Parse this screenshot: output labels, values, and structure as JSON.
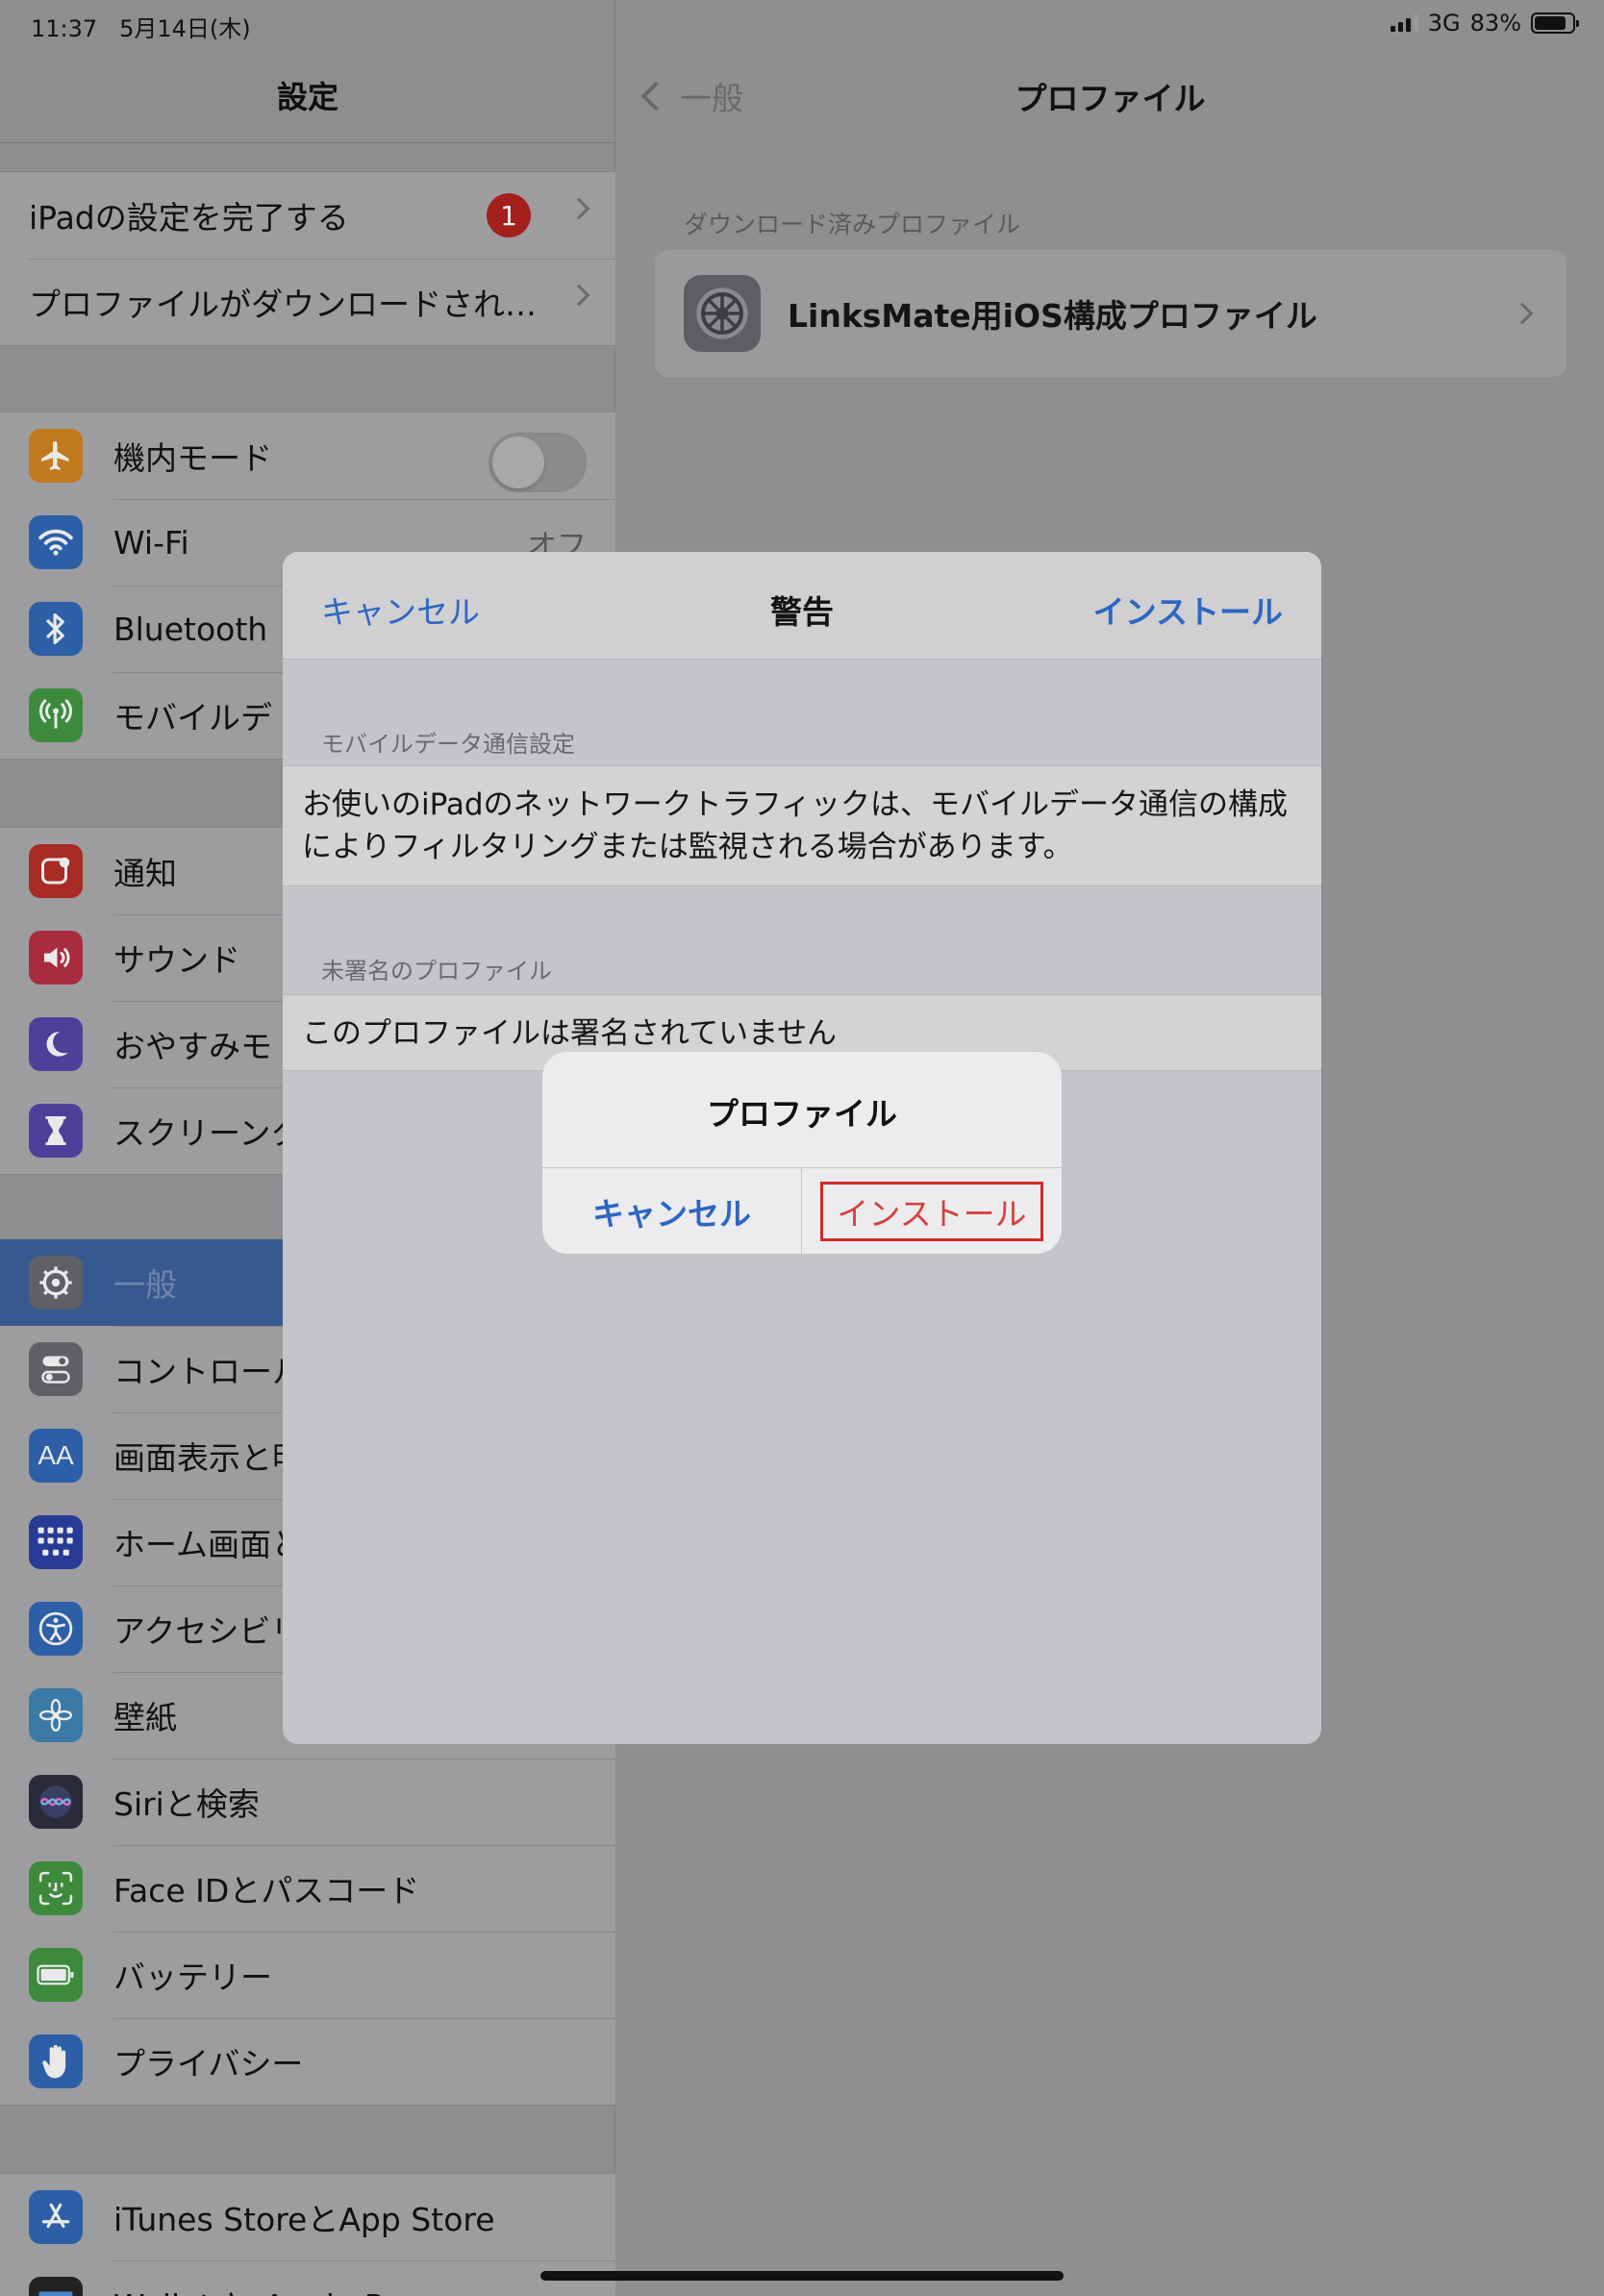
{
  "status_bar": {
    "time": "11:37",
    "date": "5月14日(木)",
    "network": "3G",
    "battery": "83%",
    "battery_level": 0.83
  },
  "sidebar": {
    "title": "設定",
    "top_items": [
      {
        "label": "iPadの設定を完了する",
        "badge": "1"
      },
      {
        "label": "プロファイルがダウンロードされ…"
      }
    ],
    "connectivity": [
      {
        "label": "機内モード",
        "icon": "airplane-icon",
        "color": "#c17a1e",
        "toggle": false
      },
      {
        "label": "Wi-Fi",
        "icon": "wifi-icon",
        "color": "#2d5fa6",
        "value": "オフ"
      },
      {
        "label": "Bluetooth",
        "icon": "bluetooth-icon",
        "color": "#2d5fa6"
      },
      {
        "label": "モバイルデ",
        "icon": "antenna-icon",
        "color": "#3e8a3d"
      }
    ],
    "notifications": [
      {
        "label": "通知",
        "icon": "notification-icon",
        "color": "#a82b25"
      },
      {
        "label": "サウンド",
        "icon": "speaker-icon",
        "color": "#a82b3e"
      },
      {
        "label": "おやすみモ",
        "icon": "moon-icon",
        "color": "#4e3f99"
      },
      {
        "label": "スクリーンタ",
        "icon": "hourglass-icon",
        "color": "#4e3f99"
      }
    ],
    "general": [
      {
        "label": "一般",
        "icon": "gear-icon",
        "color": "#5f6065",
        "selected": true
      },
      {
        "label": "コントロール",
        "icon": "switches-icon",
        "color": "#5f6065"
      },
      {
        "label": "画面表示と明",
        "icon": "text-size-icon",
        "color": "#2d5fa6"
      },
      {
        "label": "ホーム画面と",
        "icon": "home-grid-icon",
        "color": "#283b94"
      },
      {
        "label": "アクセシビリ",
        "icon": "accessibility-icon",
        "color": "#2d5fa6"
      },
      {
        "label": "壁紙",
        "icon": "flower-icon",
        "color": "#3a7aa4"
      },
      {
        "label": "Siriと検索",
        "icon": "siri-icon",
        "color": "#2a2a3a"
      },
      {
        "label": "Face IDとパスコード",
        "icon": "face-id-icon",
        "color": "#3e8a3d"
      },
      {
        "label": "バッテリー",
        "icon": "battery-icon",
        "color": "#3e8a3d"
      },
      {
        "label": "プライバシー",
        "icon": "hand-icon",
        "color": "#2d5fa6"
      }
    ],
    "store": [
      {
        "label": "iTunes StoreとApp Store",
        "icon": "app-store-icon",
        "color": "#2d5fa6"
      },
      {
        "label": "Wallet と Apple Pay",
        "icon": "wallet-icon",
        "color": "#222222"
      }
    ]
  },
  "detail": {
    "back_label": "一般",
    "title": "プロファイル",
    "section_label": "ダウンロード済みプロファイル",
    "profile_name": "LinksMate用iOS構成プロファイル"
  },
  "sheet": {
    "cancel": "キャンセル",
    "title": "警告",
    "install": "インストール",
    "section1_label": "モバイルデータ通信設定",
    "section1_text": "お使いのiPadのネットワークトラフィックは、モバイルデータ通信の構成によりフィルタリングまたは監視される場合があります。",
    "section2_label": "未署名のプロファイル",
    "section2_text": "このプロファイルは署名されていません"
  },
  "alert": {
    "title": "プロファイル",
    "cancel": "キャンセル",
    "install": "インストール"
  }
}
